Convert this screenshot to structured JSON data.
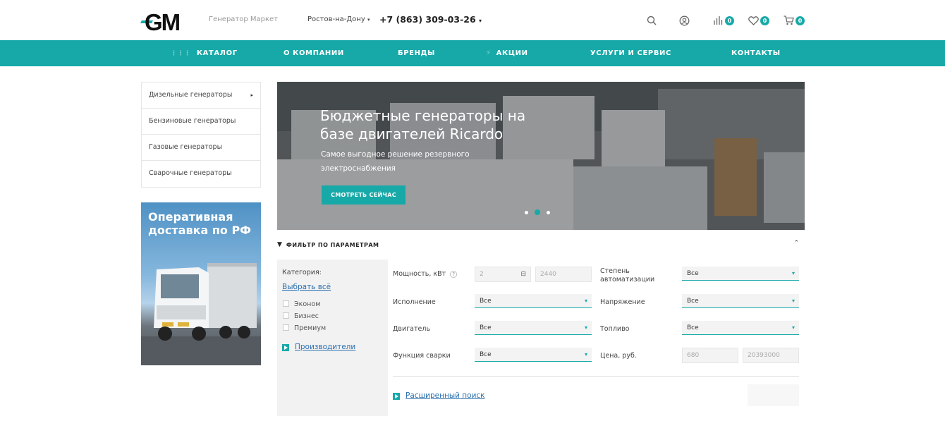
{
  "header": {
    "logo_text": "GM",
    "subtitle": "Генератор Маркет",
    "city": "Ростов-на-Дону",
    "phone": "+7 (863) 309-03-26",
    "compare_count": "0",
    "favorites_count": "0",
    "cart_count": "0",
    "accent_color": "#17a9a8"
  },
  "nav": {
    "items": [
      {
        "label": "КАТАЛОГ",
        "icon": "grid-icon"
      },
      {
        "label": "О КОМПАНИИ"
      },
      {
        "label": "БРЕНДЫ"
      },
      {
        "label": "АКЦИИ",
        "icon": "lightning-icon"
      },
      {
        "label": "УСЛУГИ И СЕРВИС"
      },
      {
        "label": "КОНТАКТЫ"
      }
    ]
  },
  "sidebar": {
    "items": [
      {
        "label": "Дизельные генераторы"
      },
      {
        "label": "Бензиновые генераторы"
      },
      {
        "label": "Газовые генераторы"
      },
      {
        "label": "Сварочные генераторы"
      }
    ]
  },
  "promo": {
    "title": "Оперативная\nдоставка по РФ"
  },
  "slider": {
    "title": "Бюджетные генераторы на\nбазе двигателей Ricardo",
    "subtitle": "Самое выгодное решение резервного электроснабжения",
    "button": "СМОТРЕТЬ СЕЙЧАС",
    "slide_count": 3,
    "active_slide": 2
  },
  "filter": {
    "title": "ФИЛЬТР ПО ПАРАМЕТРАМ",
    "category_label": "Категория:",
    "select_all": "Выбрать всё",
    "categories": [
      "Эконом",
      "Бизнес",
      "Премиум"
    ],
    "manufacturers": "Производители",
    "power_label": "Мощность, кВт",
    "power_help": "?",
    "power_min": "2",
    "power_max": "2440",
    "automation_label": "Степень автоматизации",
    "automation_value": "Все",
    "execution_label": "Исполнение",
    "execution_value": "Все",
    "voltage_label": "Напряжение",
    "voltage_value": "Все",
    "engine_label": "Двигатель",
    "engine_value": "Все",
    "fuel_label": "Топливо",
    "fuel_value": "Все",
    "welding_label": "Функция сварки",
    "welding_value": "Все",
    "price_label": "Цена, руб.",
    "price_min": "680",
    "price_max": "20393000",
    "advanced": "Расширенный поиск"
  }
}
